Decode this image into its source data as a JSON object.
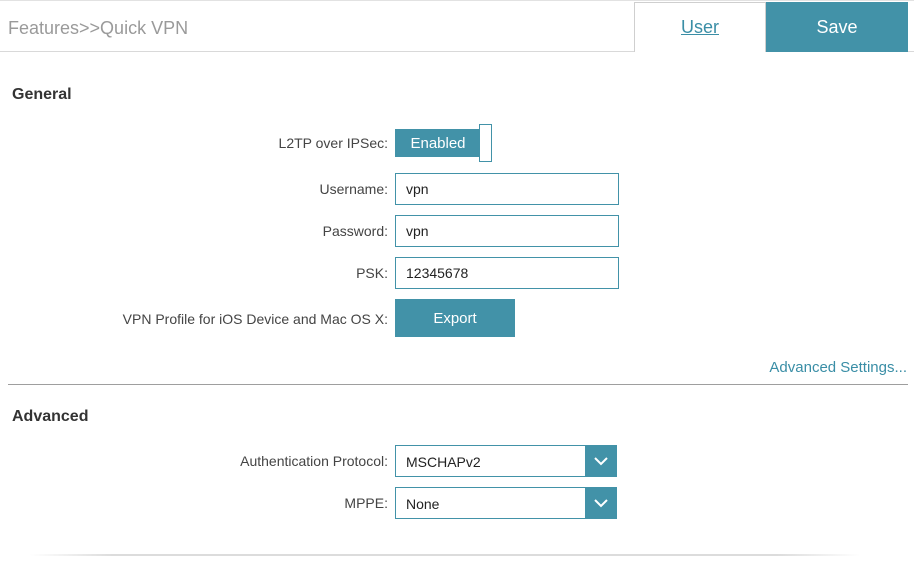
{
  "header": {
    "breadcrumb": "Features>>Quick VPN",
    "user_label": "User",
    "save_label": "Save"
  },
  "general": {
    "title": "General",
    "l2tp": {
      "label": "L2TP over IPSec:",
      "state": "Enabled"
    },
    "username": {
      "label": "Username:",
      "value": "vpn"
    },
    "password": {
      "label": "Password:",
      "value": "vpn"
    },
    "psk": {
      "label": "PSK:",
      "value": "12345678"
    },
    "vpn_profile": {
      "label": "VPN Profile for iOS Device and Mac OS X:",
      "button": "Export"
    },
    "advanced_link": "Advanced Settings..."
  },
  "advanced": {
    "title": "Advanced",
    "auth_protocol": {
      "label": "Authentication Protocol:",
      "value": "MSCHAPv2"
    },
    "mppe": {
      "label": "MPPE:",
      "value": "None"
    }
  },
  "colors": {
    "accent": "#4292a8",
    "link": "#3a8ea6"
  }
}
